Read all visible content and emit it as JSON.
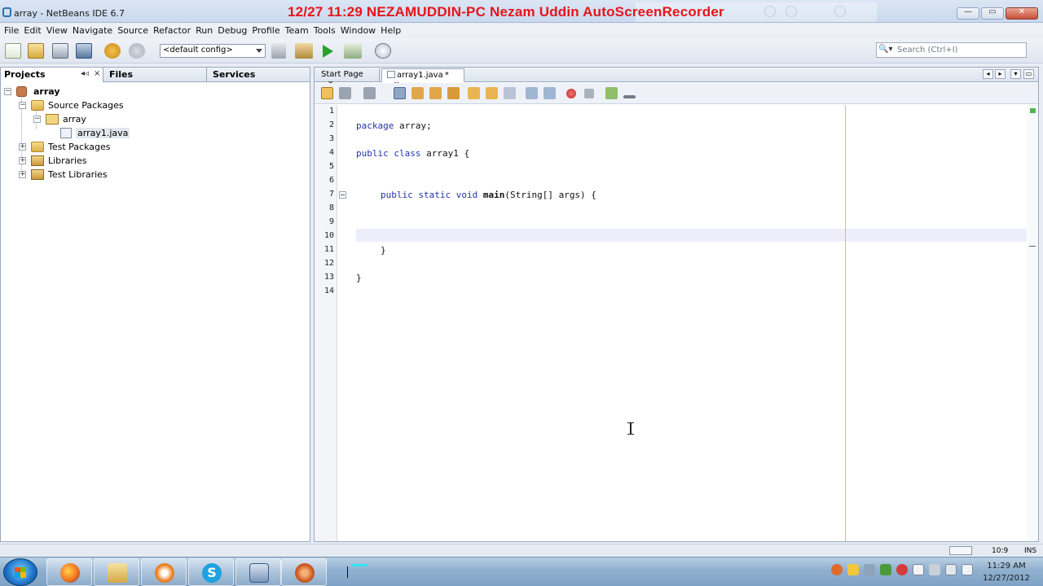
{
  "window": {
    "title": "array - NetBeans IDE 6.7",
    "overlay_text": "12/27  11:29  NEZAMUDDIN-PC  Nezam Uddin  AutoScreenRecorder",
    "buttons": {
      "minimize": "—",
      "maximize": "▭",
      "close": "✕"
    }
  },
  "menu": [
    "File",
    "Edit",
    "View",
    "Navigate",
    "Source",
    "Refactor",
    "Run",
    "Debug",
    "Profile",
    "Team",
    "Tools",
    "Window",
    "Help"
  ],
  "toolbar": {
    "config_value": "<default config>",
    "search_placeholder": "Search (Ctrl+I)",
    "icons": [
      "new-file-icon",
      "new-project-icon",
      "open-project-icon",
      "save-all-icon",
      "undo-icon",
      "redo-icon",
      "build-icon",
      "clean-build-icon",
      "run-icon",
      "debug-icon",
      "profile-icon"
    ]
  },
  "left_panel": {
    "tabs": [
      "Projects",
      "Files",
      "Services"
    ],
    "tab_controls": {
      "minimize": "◂◃",
      "close": "×"
    },
    "tree": {
      "project": "array",
      "source_packages": "Source Packages",
      "package": "array",
      "file": "array1.java",
      "test_packages": "Test Packages",
      "libraries": "Libraries",
      "test_libraries": "Test Libraries"
    }
  },
  "editor": {
    "tabs": [
      {
        "label": "Start Page",
        "close": "×"
      },
      {
        "label": "array1.java",
        "modified": "*",
        "close": "×"
      }
    ],
    "line_numbers": [
      "1",
      "2",
      "3",
      "4",
      "5",
      "6",
      "7",
      "8",
      "9",
      "10",
      "11",
      "12",
      "13",
      "14"
    ],
    "code": {
      "l2_kw": "package",
      "l2_rest": " array;",
      "l4_kw": "public class",
      "l4_rest": " array1 {",
      "l7_kw": "public static void",
      "l7_main": "main",
      "l7_rest": "(String[] args) {",
      "l11": "}",
      "l13": "}"
    },
    "current_line": 10
  },
  "status": {
    "position": "10:9",
    "mode": "INS"
  },
  "taskbar": {
    "apps": [
      "firefox-icon",
      "file-explorer-icon",
      "media-player-icon",
      "skype-icon",
      "virtualbox-icon",
      "netbeans-icon"
    ],
    "clock_time": "11:29 AM",
    "clock_date": "12/27/2012"
  }
}
